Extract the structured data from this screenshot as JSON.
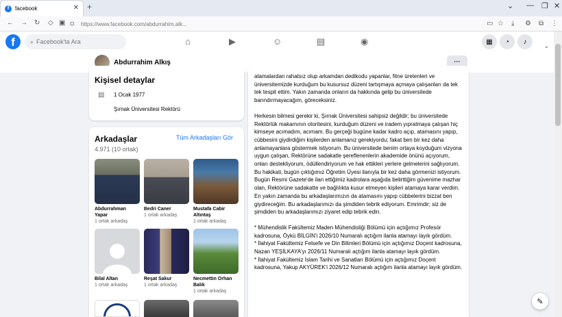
{
  "browser": {
    "tab_title": "facebook",
    "tab_favicon": "f",
    "tab_close": "✕",
    "new_tab": "+",
    "url": "https://www.facebook.com/abdurrahim.alk..."
  },
  "header": {
    "logo": "f",
    "search_placeholder": "Facebook'ta Ara"
  },
  "profile": {
    "name": "Abdurrahim Alkış",
    "more_label": "···"
  },
  "details": {
    "title": "Kişisel detaylar",
    "birth_date": "1 Ocak 1977",
    "workplace": "Şırnak Üniversitesi Rektörü"
  },
  "friends": {
    "title": "Arkadaşlar",
    "see_all": "Tüm Arkadaşları Gör",
    "count": "4.971 (10 ortak)",
    "items": [
      {
        "name": "Abdurrahman Yapar",
        "mutual": "1 ortak arkadaş"
      },
      {
        "name": "Bedri Caner",
        "mutual": "1 ortak arkadaş"
      },
      {
        "name": "Mustafa Cabir Altıntaş",
        "mutual": "1 ortak arkadaş"
      },
      {
        "name": "Bilal Altan",
        "mutual": "1 ortak arkadaş"
      },
      {
        "name": "Reşat Sakur",
        "mutual": "1 ortak arkadaş"
      },
      {
        "name": "Necmettin Orhan Balık",
        "mutual": "1 ortak arkadaş"
      }
    ]
  },
  "post": {
    "paragraphs": [
      "atamalardan rahatsız olup arkamdan dedikodu yapanlar, fitne üretenleri ve üniversitemizde kurduğum bu kusursuz düzeni tartışmaya açmaya çalışanları da tek tek tespit ettim. Yakın zamanda onların da hakkında gelip bu üniversitede barındırmayacağım, göreceksiniz.",
      "Herkesin bilmesi gerekir ki, Şırnak Üniversitesi sahipsiz değildir; bu üniversitede Rektörlük makamının otoritesini, kurduğum düzeni ve iradem yıpratmaya çalışan hiç kimseye acımadım, acımam. Bu gerçeği bugüne kadar kadro açıp, atamasını yapıp, cübbesini giydirdiğim kişilerden anlamanız gerekiyordu; fakat ben bir kez daha anlamayanlara göstermek istiyorum. Bu üniversitede benim ortaya koyduğum vizyona uygun çalışan, Rektörüne sadakatle şereflenenlerin akademide önünü açıyorum, onları destekliyorum, ödüllendiriyorum ve hak ettikleri yerlere gelmelerini sağlıyorum. Bu hakikati, bugün çıktığımız Öğretim Üyesi ilanıyla bir kez daha görmenizi istiyorum. Bugün Resmi Gazete'de ilan ettiğimiz kadrolara aşağıda belirttiğim güvenime mazhar olan, Rektörüne sadakatte ve bağlılıkta kusur etmeyen kişileri atamaya karar verdim. En yakın zamanda bu arkadaşlarımızın da atamasını yapıp cübbelerini bizzat ben giydireceğim. Bu arkadaşlarımızı da şimdiden tebrik ediyorum. Emrimdir; siz de şimdiden bu arkadaşlarımızı ziyaret edip tebrik edin.",
      "* Mühendislik Fakültemiz Maden Mühendisliği Bölümü için açtığımız Profesör kadrosuna, Öykü BİLGİN'i 2026/10 Numaralı açtığım ilanla atamayı layık gördüm.\n* İlahiyat Fakültemiz Felsefe ve Din Bilimleri Bölümü için açtığımız Doçent kadrosuna, Nazan YEŞİLKAYA'yı 2026/11 Numaralı açtığım ilanla atamayı layık gördüm.\n* İlahiyat Fakültemiz İslam Tarihi ve Sanatları Bölümü için açtığımız Doçent kadrosuna, Yakup AKYÜREK'i 2026/12 Numaralı açtığım ilanla atamayı layık gördüm."
    ]
  },
  "colors": {
    "brand": "#1877f2",
    "background": "#f0f2f5"
  },
  "icons": [
    "facebook-logo-icon",
    "search-icon",
    "home-icon",
    "video-icon",
    "groups-icon",
    "marketplace-icon",
    "gaming-icon",
    "menu-grid-icon",
    "messenger-icon",
    "notifications-icon",
    "chevron-down-icon",
    "cake-icon",
    "edit-icon"
  ]
}
